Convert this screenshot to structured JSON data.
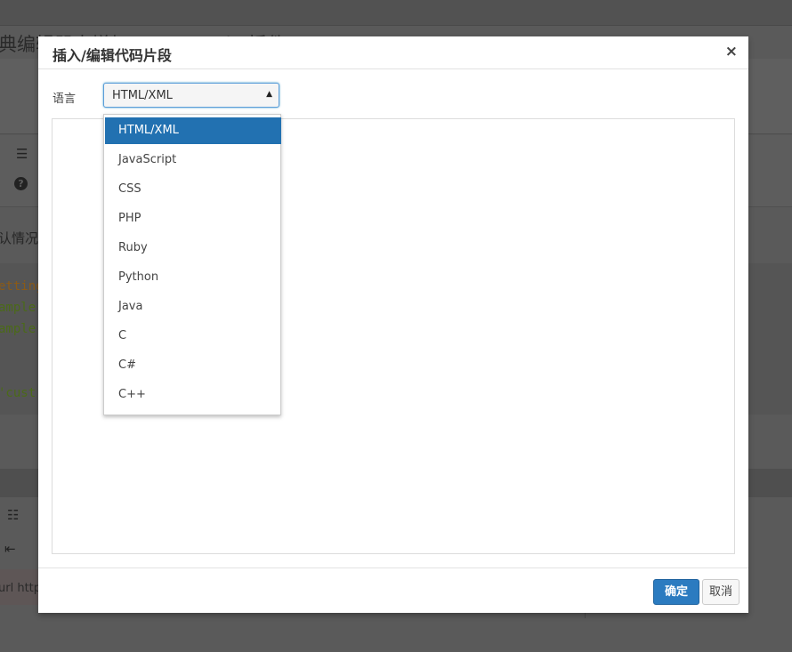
{
  "background": {
    "title": "典编辑器中增加 Insert Code 插件",
    "text1": "认情况",
    "code_lines": [
      "etting",
      "ample",
      "ample",
      "'cust"
    ],
    "url_text": "url http"
  },
  "dialog": {
    "title": "插入/编辑代码片段",
    "close_symbol": "×",
    "language_label": "语言",
    "selected_language": "HTML/XML",
    "ok_label": "确定",
    "cancel_label": "取消"
  },
  "languages": [
    "HTML/XML",
    "JavaScript",
    "CSS",
    "PHP",
    "Ruby",
    "Python",
    "Java",
    "C",
    "C#",
    "C++"
  ],
  "colors": {
    "accent": "#2271b1",
    "button_primary": "#2b7bc0"
  }
}
